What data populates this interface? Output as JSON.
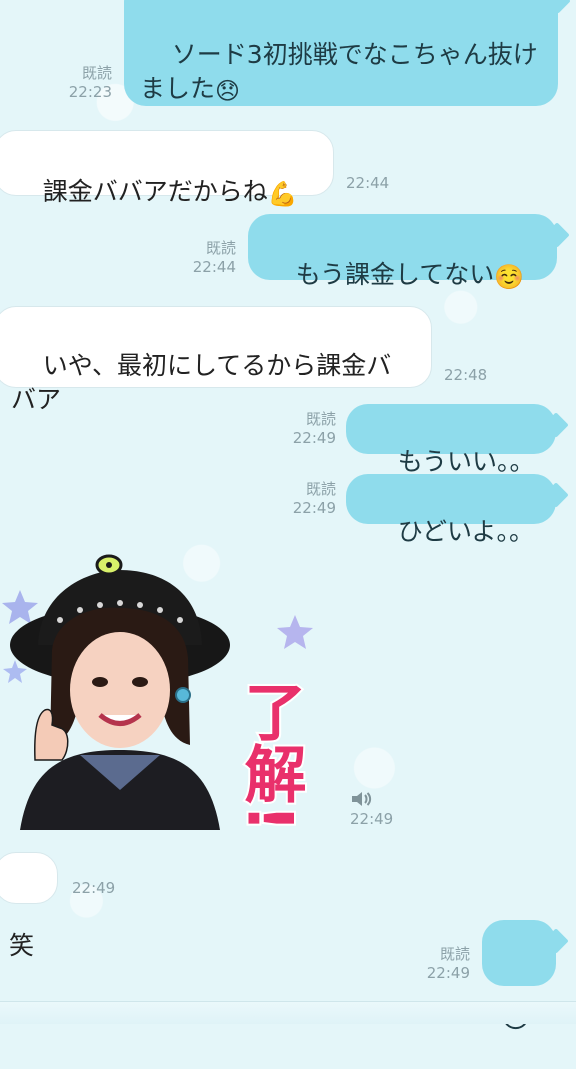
{
  "messages": [
    {
      "id": "m1",
      "direction": "sent",
      "text": "ソード3初挑戦でなこちゃん抜けました",
      "emoji": "😞",
      "read_label": "既読",
      "time": "22:23"
    },
    {
      "id": "m2",
      "direction": "received",
      "text": "課金ババアだからね",
      "emoji": "💪",
      "time": "22:44"
    },
    {
      "id": "m3",
      "direction": "sent",
      "text": "もう課金してない",
      "emoji": "☺️",
      "read_label": "既読",
      "time": "22:44"
    },
    {
      "id": "m4",
      "direction": "received",
      "text": "いや、最初にしてるから課金ババア",
      "time": "22:48"
    },
    {
      "id": "m5",
      "direction": "sent",
      "text": "もういい。。",
      "read_label": "既読",
      "time": "22:49"
    },
    {
      "id": "m6",
      "direction": "sent",
      "text": "ひどいよ。。",
      "read_label": "既読",
      "time": "22:49"
    },
    {
      "id": "m7",
      "direction": "received",
      "type": "sticker",
      "sticker_text": "了解!!",
      "sticker_icon": "speaker-icon",
      "time": "22:49"
    },
    {
      "id": "m8",
      "direction": "received",
      "text": "笑",
      "time": "22:49"
    },
    {
      "id": "m9",
      "direction": "sent",
      "emoji": "😞",
      "read_label": "既読",
      "time": "22:49"
    }
  ],
  "colors": {
    "background": "#e4f6f9",
    "sent_bubble": "#8fdcec",
    "received_bubble": "#ffffff",
    "meta_text": "#8ca1a8",
    "sticker_text": "#e9306b"
  }
}
